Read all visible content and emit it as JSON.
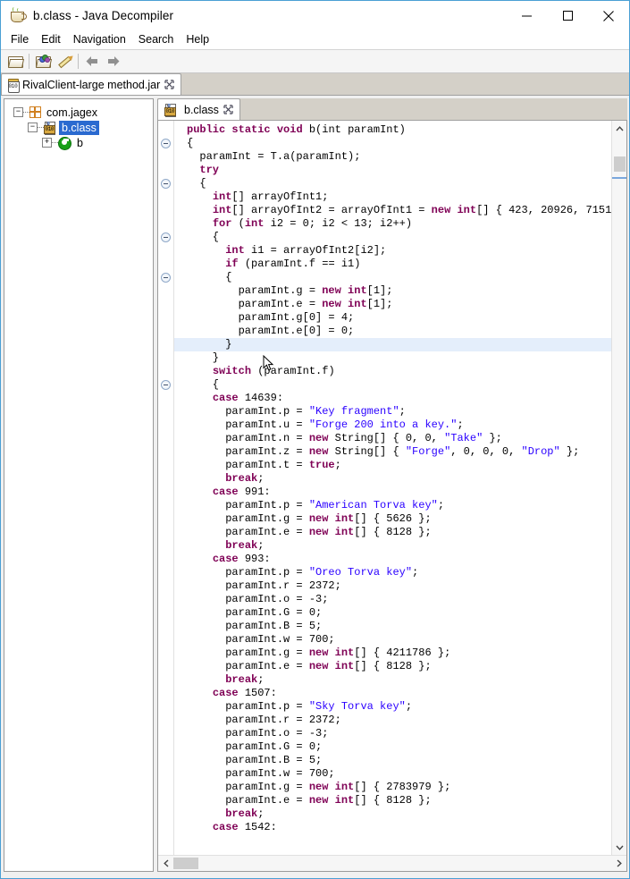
{
  "window": {
    "title": "b.class - Java Decompiler",
    "icon": "java-coffee-cup-icon",
    "controls": {
      "minimize": "minimize-icon",
      "maximize": "maximize-icon",
      "close": "close-icon"
    }
  },
  "menubar": {
    "items": [
      "File",
      "Edit",
      "Navigation",
      "Search",
      "Help"
    ]
  },
  "toolbar": {
    "buttons": [
      {
        "name": "open-folder-icon",
        "tooltip": "Open"
      },
      {
        "name": "open-type-icon",
        "tooltip": "Open Type"
      },
      {
        "name": "pencil-icon",
        "tooltip": "Edit"
      },
      {
        "name": "back-arrow-icon",
        "tooltip": "Back"
      },
      {
        "name": "forward-arrow-icon",
        "tooltip": "Forward"
      }
    ]
  },
  "jar_tabs": [
    {
      "label": "RivalClient-large method.jar",
      "icon": "jar-file-icon",
      "close": "close-tab-icon",
      "active": true
    }
  ],
  "tree": {
    "nodes": [
      {
        "label": "com.jagex",
        "icon": "package-icon",
        "expander": "minus",
        "depth": 0,
        "selected": false
      },
      {
        "label": "b.class",
        "icon": "class-file-icon",
        "expander": "minus",
        "depth": 1,
        "selected": true
      },
      {
        "label": "b",
        "icon": "method-icon",
        "expander": "plus",
        "depth": 2,
        "selected": false
      }
    ]
  },
  "editor_tabs": [
    {
      "label": "b.class",
      "icon": "class-file-icon",
      "close": "close-tab-icon",
      "active": true
    }
  ],
  "colors": {
    "keyword": "#7f0055",
    "string": "#2a00ff",
    "plain": "#000000",
    "selection_line": "#e4eefb",
    "tree_selection": "#2a6ad0",
    "window_border": "#4a9fd4"
  },
  "code": {
    "language": "java",
    "lines": [
      {
        "t": [
          [
            "kw",
            "public"
          ],
          [
            "pl",
            " "
          ],
          [
            "kw",
            "static"
          ],
          [
            "pl",
            " "
          ],
          [
            "kw",
            "void"
          ],
          [
            "pl",
            " b(int paramInt)"
          ]
        ],
        "indent": 0
      },
      {
        "t": [
          [
            "pl",
            "{"
          ]
        ],
        "fold": true
      },
      {
        "t": [
          [
            "pl",
            "  paramInt = T.a(paramInt);"
          ]
        ]
      },
      {
        "t": [
          [
            "pl",
            "  "
          ],
          [
            "kw",
            "try"
          ]
        ]
      },
      {
        "t": [
          [
            "pl",
            "  {"
          ]
        ],
        "fold": true
      },
      {
        "t": [
          [
            "pl",
            "    "
          ],
          [
            "kw",
            "int"
          ],
          [
            "pl",
            "[] arrayOfInt1;"
          ]
        ]
      },
      {
        "t": [
          [
            "pl",
            "    "
          ],
          [
            "kw",
            "int"
          ],
          [
            "pl",
            "[] arrayOfInt2 = arrayOfInt1 = "
          ],
          [
            "kw",
            "new"
          ],
          [
            "pl",
            " "
          ],
          [
            "kw",
            "int"
          ],
          [
            "pl",
            "[] { 423, 20926, 7151"
          ]
        ]
      },
      {
        "t": [
          [
            "pl",
            "    "
          ],
          [
            "kw",
            "for"
          ],
          [
            "pl",
            " ("
          ],
          [
            "kw",
            "int"
          ],
          [
            "pl",
            " i2 = 0; i2 < 13; i2++)"
          ]
        ]
      },
      {
        "t": [
          [
            "pl",
            "    {"
          ]
        ],
        "fold": true
      },
      {
        "t": [
          [
            "pl",
            "      "
          ],
          [
            "kw",
            "int"
          ],
          [
            "pl",
            " i1 = arrayOfInt2[i2];"
          ]
        ]
      },
      {
        "t": [
          [
            "pl",
            "      "
          ],
          [
            "kw",
            "if"
          ],
          [
            "pl",
            " (paramInt.f == i1)"
          ]
        ]
      },
      {
        "t": [
          [
            "pl",
            "      {"
          ]
        ],
        "fold": true
      },
      {
        "t": [
          [
            "pl",
            "        paramInt.g = "
          ],
          [
            "kw",
            "new"
          ],
          [
            "pl",
            " "
          ],
          [
            "kw",
            "int"
          ],
          [
            "pl",
            "[1];"
          ]
        ]
      },
      {
        "t": [
          [
            "pl",
            "        paramInt.e = "
          ],
          [
            "kw",
            "new"
          ],
          [
            "pl",
            " "
          ],
          [
            "kw",
            "int"
          ],
          [
            "pl",
            "[1];"
          ]
        ]
      },
      {
        "t": [
          [
            "pl",
            "        paramInt.g[0] = 4;"
          ]
        ]
      },
      {
        "t": [
          [
            "pl",
            "        paramInt.e[0] = 0;"
          ]
        ]
      },
      {
        "t": [
          [
            "pl",
            "      }"
          ]
        ],
        "highlight": true
      },
      {
        "t": [
          [
            "pl",
            "    }"
          ]
        ]
      },
      {
        "t": [
          [
            "pl",
            "    "
          ],
          [
            "kw",
            "switch"
          ],
          [
            "pl",
            " (paramInt.f)"
          ]
        ]
      },
      {
        "t": [
          [
            "pl",
            "    {"
          ]
        ],
        "fold": true
      },
      {
        "t": [
          [
            "pl",
            "    "
          ],
          [
            "kw",
            "case"
          ],
          [
            "pl",
            " 14639:"
          ]
        ]
      },
      {
        "t": [
          [
            "pl",
            "      paramInt.p = "
          ],
          [
            "str",
            "\"Key fragment\""
          ],
          [
            "pl",
            ";"
          ]
        ]
      },
      {
        "t": [
          [
            "pl",
            "      paramInt.u = "
          ],
          [
            "str",
            "\"Forge 200 into a key.\""
          ],
          [
            "pl",
            ";"
          ]
        ]
      },
      {
        "t": [
          [
            "pl",
            "      paramInt.n = "
          ],
          [
            "kw",
            "new"
          ],
          [
            "pl",
            " String[] { 0, 0, "
          ],
          [
            "str",
            "\"Take\""
          ],
          [
            "pl",
            " };"
          ]
        ]
      },
      {
        "t": [
          [
            "pl",
            "      paramInt.z = "
          ],
          [
            "kw",
            "new"
          ],
          [
            "pl",
            " String[] { "
          ],
          [
            "str",
            "\"Forge\""
          ],
          [
            "pl",
            ", 0, 0, 0, "
          ],
          [
            "str",
            "\"Drop\""
          ],
          [
            "pl",
            " };"
          ]
        ]
      },
      {
        "t": [
          [
            "pl",
            "      paramInt.t = "
          ],
          [
            "kw",
            "true"
          ],
          [
            "pl",
            ";"
          ]
        ]
      },
      {
        "t": [
          [
            "pl",
            "      "
          ],
          [
            "kw",
            "break"
          ],
          [
            "pl",
            ";"
          ]
        ]
      },
      {
        "t": [
          [
            "pl",
            "    "
          ],
          [
            "kw",
            "case"
          ],
          [
            "pl",
            " 991:"
          ]
        ]
      },
      {
        "t": [
          [
            "pl",
            "      paramInt.p = "
          ],
          [
            "str",
            "\"American Torva key\""
          ],
          [
            "pl",
            ";"
          ]
        ]
      },
      {
        "t": [
          [
            "pl",
            "      paramInt.g = "
          ],
          [
            "kw",
            "new"
          ],
          [
            "pl",
            " "
          ],
          [
            "kw",
            "int"
          ],
          [
            "pl",
            "[] { 5626 };"
          ]
        ]
      },
      {
        "t": [
          [
            "pl",
            "      paramInt.e = "
          ],
          [
            "kw",
            "new"
          ],
          [
            "pl",
            " "
          ],
          [
            "kw",
            "int"
          ],
          [
            "pl",
            "[] { 8128 };"
          ]
        ]
      },
      {
        "t": [
          [
            "pl",
            "      "
          ],
          [
            "kw",
            "break"
          ],
          [
            "pl",
            ";"
          ]
        ]
      },
      {
        "t": [
          [
            "pl",
            "    "
          ],
          [
            "kw",
            "case"
          ],
          [
            "pl",
            " 993:"
          ]
        ]
      },
      {
        "t": [
          [
            "pl",
            "      paramInt.p = "
          ],
          [
            "str",
            "\"Oreo Torva key\""
          ],
          [
            "pl",
            ";"
          ]
        ]
      },
      {
        "t": [
          [
            "pl",
            "      paramInt.r = 2372;"
          ]
        ]
      },
      {
        "t": [
          [
            "pl",
            "      paramInt.o = -3;"
          ]
        ]
      },
      {
        "t": [
          [
            "pl",
            "      paramInt.G = 0;"
          ]
        ]
      },
      {
        "t": [
          [
            "pl",
            "      paramInt.B = 5;"
          ]
        ]
      },
      {
        "t": [
          [
            "pl",
            "      paramInt.w = 700;"
          ]
        ]
      },
      {
        "t": [
          [
            "pl",
            "      paramInt.g = "
          ],
          [
            "kw",
            "new"
          ],
          [
            "pl",
            " "
          ],
          [
            "kw",
            "int"
          ],
          [
            "pl",
            "[] { 4211786 };"
          ]
        ]
      },
      {
        "t": [
          [
            "pl",
            "      paramInt.e = "
          ],
          [
            "kw",
            "new"
          ],
          [
            "pl",
            " "
          ],
          [
            "kw",
            "int"
          ],
          [
            "pl",
            "[] { 8128 };"
          ]
        ]
      },
      {
        "t": [
          [
            "pl",
            "      "
          ],
          [
            "kw",
            "break"
          ],
          [
            "pl",
            ";"
          ]
        ]
      },
      {
        "t": [
          [
            "pl",
            "    "
          ],
          [
            "kw",
            "case"
          ],
          [
            "pl",
            " 1507:"
          ]
        ]
      },
      {
        "t": [
          [
            "pl",
            "      paramInt.p = "
          ],
          [
            "str",
            "\"Sky Torva key\""
          ],
          [
            "pl",
            ";"
          ]
        ]
      },
      {
        "t": [
          [
            "pl",
            "      paramInt.r = 2372;"
          ]
        ]
      },
      {
        "t": [
          [
            "pl",
            "      paramInt.o = -3;"
          ]
        ]
      },
      {
        "t": [
          [
            "pl",
            "      paramInt.G = 0;"
          ]
        ]
      },
      {
        "t": [
          [
            "pl",
            "      paramInt.B = 5;"
          ]
        ]
      },
      {
        "t": [
          [
            "pl",
            "      paramInt.w = 700;"
          ]
        ]
      },
      {
        "t": [
          [
            "pl",
            "      paramInt.g = "
          ],
          [
            "kw",
            "new"
          ],
          [
            "pl",
            " "
          ],
          [
            "kw",
            "int"
          ],
          [
            "pl",
            "[] { 2783979 };"
          ]
        ]
      },
      {
        "t": [
          [
            "pl",
            "      paramInt.e = "
          ],
          [
            "kw",
            "new"
          ],
          [
            "pl",
            " "
          ],
          [
            "kw",
            "int"
          ],
          [
            "pl",
            "[] { 8128 };"
          ]
        ]
      },
      {
        "t": [
          [
            "pl",
            "      "
          ],
          [
            "kw",
            "break"
          ],
          [
            "pl",
            ";"
          ]
        ]
      },
      {
        "t": [
          [
            "pl",
            "    "
          ],
          [
            "kw",
            "case"
          ],
          [
            "pl",
            " 1542:"
          ]
        ]
      }
    ]
  },
  "scrollbars": {
    "vertical": {
      "up": "scroll-up-icon",
      "down": "scroll-down-icon",
      "thumb_top_pct": 5,
      "marker": true
    },
    "horizontal": {
      "left": "scroll-left-icon",
      "right": "scroll-right-icon",
      "thumb_left_pct": 0
    }
  }
}
